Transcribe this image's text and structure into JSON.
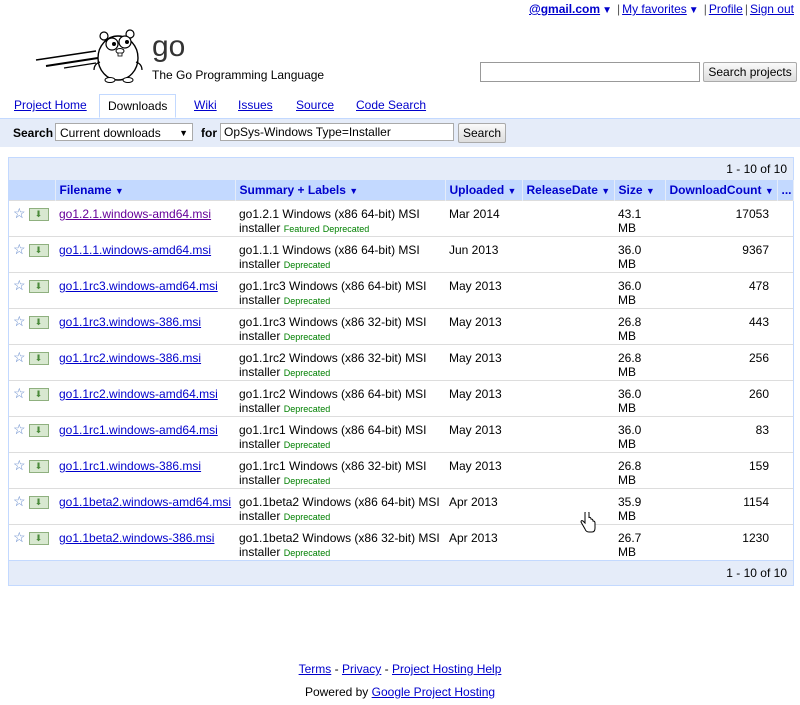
{
  "account": {
    "email": "@gmail.com",
    "favorites": "My favorites",
    "profile": "Profile",
    "signout": "Sign out",
    "sep": "|"
  },
  "project": {
    "name": "go",
    "summary": "The Go Programming Language",
    "search_button": "Search projects"
  },
  "tabs": [
    {
      "label": "Project Home",
      "active": false
    },
    {
      "label": "Downloads",
      "active": true
    },
    {
      "label": "Wiki",
      "active": false
    },
    {
      "label": "Issues",
      "active": false
    },
    {
      "label": "Source",
      "active": false
    },
    {
      "label": "Code Search",
      "active": false
    }
  ],
  "search": {
    "label": "Search",
    "scope": "Current downloads",
    "for_label": "for",
    "query": "OpSys-Windows Type=Installer",
    "button": "Search"
  },
  "pagination": "1 - 10 of 10",
  "columns": [
    "Filename",
    "Summary + Labels",
    "Uploaded",
    "ReleaseDate",
    "Size",
    "DownloadCount",
    "..."
  ],
  "rows": [
    {
      "filename": "go1.2.1.windows-amd64.msi",
      "summary_1": "go1.2.1 Windows (x86 64-bit) MSI",
      "summary_2": "installer",
      "labels": [
        "Featured",
        "Deprecated"
      ],
      "uploaded": "Mar 2014",
      "release": "",
      "size": "43.1 MB",
      "count": "17053"
    },
    {
      "filename": "go1.1.1.windows-amd64.msi",
      "summary_1": "go1.1.1 Windows (x86 64-bit) MSI",
      "summary_2": "installer",
      "labels": [
        "Deprecated"
      ],
      "uploaded": "Jun 2013",
      "release": "",
      "size": "36.0 MB",
      "count": "9367"
    },
    {
      "filename": "go1.1rc3.windows-amd64.msi",
      "summary_1": "go1.1rc3 Windows (x86 64-bit) MSI",
      "summary_2": "installer",
      "labels": [
        "Deprecated"
      ],
      "uploaded": "May 2013",
      "release": "",
      "size": "36.0 MB",
      "count": "478"
    },
    {
      "filename": "go1.1rc3.windows-386.msi",
      "summary_1": "go1.1rc3 Windows (x86 32-bit) MSI",
      "summary_2": "installer",
      "labels": [
        "Deprecated"
      ],
      "uploaded": "May 2013",
      "release": "",
      "size": "26.8 MB",
      "count": "443"
    },
    {
      "filename": "go1.1rc2.windows-386.msi",
      "summary_1": "go1.1rc2 Windows (x86 32-bit) MSI",
      "summary_2": "installer",
      "labels": [
        "Deprecated"
      ],
      "uploaded": "May 2013",
      "release": "",
      "size": "26.8 MB",
      "count": "256"
    },
    {
      "filename": "go1.1rc2.windows-amd64.msi",
      "summary_1": "go1.1rc2 Windows (x86 64-bit) MSI",
      "summary_2": "installer",
      "labels": [
        "Deprecated"
      ],
      "uploaded": "May 2013",
      "release": "",
      "size": "36.0 MB",
      "count": "260"
    },
    {
      "filename": "go1.1rc1.windows-amd64.msi",
      "summary_1": "go1.1rc1 Windows (x86 64-bit) MSI",
      "summary_2": "installer",
      "labels": [
        "Deprecated"
      ],
      "uploaded": "May 2013",
      "release": "",
      "size": "36.0 MB",
      "count": "83"
    },
    {
      "filename": "go1.1rc1.windows-386.msi",
      "summary_1": "go1.1rc1 Windows (x86 32-bit) MSI",
      "summary_2": "installer",
      "labels": [
        "Deprecated"
      ],
      "uploaded": "May 2013",
      "release": "",
      "size": "26.8 MB",
      "count": "159"
    },
    {
      "filename": "go1.1beta2.windows-amd64.msi",
      "summary_1": "go1.1beta2 Windows (x86 64-bit) MSI",
      "summary_2": "installer",
      "labels": [
        "Deprecated"
      ],
      "uploaded": "Apr 2013",
      "release": "",
      "size": "35.9 MB",
      "count": "1154"
    },
    {
      "filename": "go1.1beta2.windows-386.msi",
      "summary_1": "go1.1beta2 Windows (x86 32-bit) MSI",
      "summary_2": "installer",
      "labels": [
        "Deprecated"
      ],
      "uploaded": "Apr 2013",
      "release": "",
      "size": "26.7 MB",
      "count": "1230"
    }
  ],
  "footer": {
    "terms": "Terms",
    "privacy": "Privacy",
    "help": "Project Hosting Help",
    "dash": "-",
    "powered_by": "Powered by",
    "hosting": "Google Project Hosting"
  },
  "colors": {
    "tab_border": "#c3d9ff",
    "search_bg": "#e5ecf9",
    "link": "#0000cc",
    "label_green": "#008000"
  }
}
